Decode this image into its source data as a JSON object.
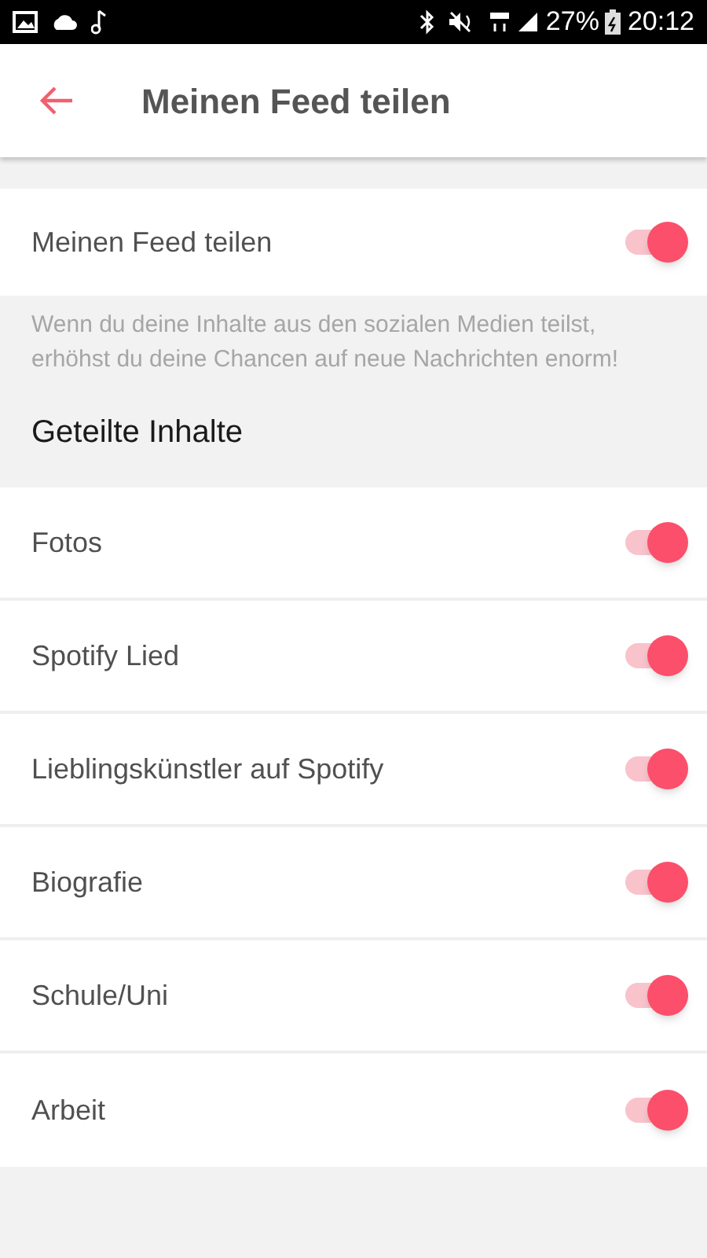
{
  "status_bar": {
    "battery": "27%",
    "time": "20:12"
  },
  "header": {
    "title": "Meinen Feed teilen"
  },
  "main_toggle": {
    "label": "Meinen Feed teilen",
    "on": true
  },
  "description": "Wenn du deine Inhalte aus den sozialen Medien teilst, erhöhst du deine Chancen auf neue Nachrichten enorm!",
  "section": {
    "title": "Geteilte Inhalte"
  },
  "items": [
    {
      "label": "Fotos",
      "on": true
    },
    {
      "label": "Spotify Lied",
      "on": true
    },
    {
      "label": "Lieblingskünstler auf Spotify",
      "on": true
    },
    {
      "label": "Biografie",
      "on": true
    },
    {
      "label": "Schule/Uni",
      "on": true
    },
    {
      "label": "Arbeit",
      "on": true
    }
  ]
}
